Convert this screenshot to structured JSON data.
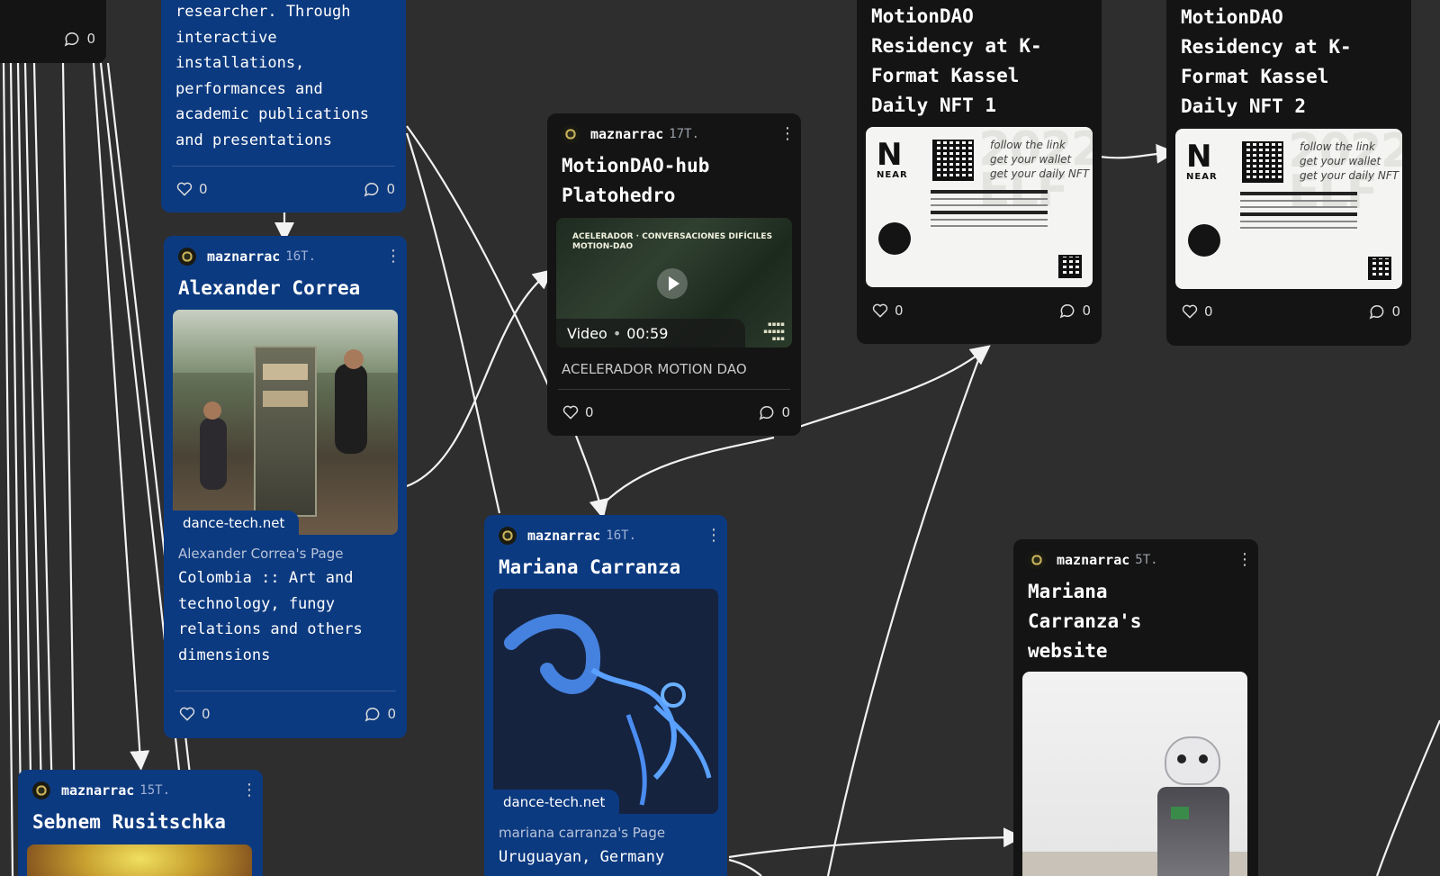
{
  "cards": {
    "top_left": {
      "comments": "0"
    },
    "researcher": {
      "desc": "researcher. Through\ninteractive\ninstallations,\nperformances and\nacademic publications\nand presentations",
      "likes": "0",
      "comments": "0"
    },
    "alexander": {
      "author": "maznarrac",
      "age": "16T.",
      "title": "Alexander Correa",
      "thumb_tag": "dance-tech.net",
      "subtitle": "Alexander Correa's Page",
      "desc": "Colombia :: Art and\ntechnology, fungy\nrelations and others\ndimensions",
      "likes": "0",
      "comments": "0"
    },
    "sebnem": {
      "author": "maznarrac",
      "age": "15T.",
      "title": "Sebnem Rusitschka"
    },
    "motionhub": {
      "author": "maznarrac",
      "age": "17T.",
      "title": "MotionDAO-hub\nPlatohedro",
      "video_label": "Video",
      "video_duration": "00:59",
      "subtitle": "ACELERADOR MOTION DAO",
      "video_overlay": "ACELERADOR · CONVERSACIONES DIFÍCILES\nMOTION-DAO",
      "likes": "0",
      "comments": "0"
    },
    "mariana": {
      "author": "maznarrac",
      "age": "16T.",
      "title": "Mariana Carranza",
      "thumb_tag": "dance-tech.net",
      "subtitle": "mariana carranza's Page",
      "desc": "Uruguayan, Germany"
    },
    "nft1": {
      "title": "MotionDAO\nResidency at K-\nFormat Kassel\nDaily NFT 1",
      "tile_text": "follow the link\nget your wallet\nget your daily NFT",
      "likes": "0",
      "comments": "0"
    },
    "nft2": {
      "title": "MotionDAO\nResidency at K-\nFormat Kassel\nDaily NFT 2",
      "tile_text": "follow the link\nget your wallet\nget your daily NFT",
      "likes": "0",
      "comments": "0"
    },
    "website": {
      "author": "maznarrac",
      "age": "5T.",
      "title": "Mariana\nCarranza's\nwebsite"
    }
  },
  "nft_brand": {
    "letter": "N",
    "word": "NEAR"
  },
  "icons": {
    "like": "heart-icon",
    "comment": "comment-icon",
    "menu": "more-vertical-icon",
    "play": "play-icon"
  },
  "colors": {
    "background": "#2e2e2f",
    "card_dark": "#141414",
    "card_blue": "#0c3a80"
  }
}
